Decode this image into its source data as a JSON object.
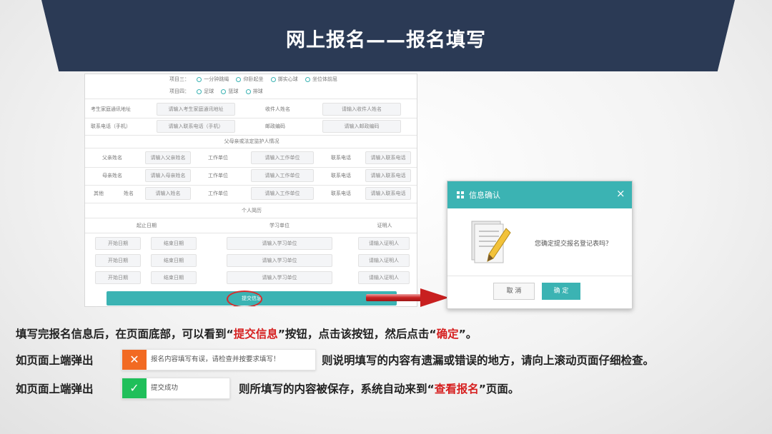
{
  "header": {
    "title": "网上报名——报名填写"
  },
  "form": {
    "top_items": [
      {
        "label": "项目三：",
        "options": [
          "一分钟跳绳",
          "仰卧起坐",
          "掷实心球",
          "坐位体前屈"
        ]
      },
      {
        "label": "项目四：",
        "options": [
          "足球",
          "篮球",
          "排球"
        ]
      }
    ],
    "fields": [
      {
        "label": "考生家庭通讯地址",
        "placeholder": "请输入考生家庭通讯地址",
        "label2": "收件人姓名",
        "placeholder2": "请输入收件人姓名"
      },
      {
        "label": "联系电话（手机）",
        "placeholder": "请输入联系电话（手机）",
        "label2": "邮政编码",
        "placeholder2": "请输入邮政编码"
      }
    ],
    "guardian_section": "父母亲或法定监护人情况",
    "guardians": [
      {
        "label": "父亲姓名",
        "placeholder": "请输入父亲姓名",
        "work_label": "工作单位",
        "work_placeholder": "请输入工作单位",
        "phone_label": "联系电话",
        "phone_placeholder": "请输入联系电话"
      },
      {
        "label": "母亲姓名",
        "placeholder": "请输入母亲姓名",
        "work_label": "工作单位",
        "work_placeholder": "请输入工作单位",
        "phone_label": "联系电话",
        "phone_placeholder": "请输入联系电话"
      },
      {
        "label": "其他",
        "label_b": "姓名",
        "placeholder": "请输入姓名",
        "work_label": "工作单位",
        "work_placeholder": "请输入工作单位",
        "phone_label": "联系电话",
        "phone_placeholder": "请输入联系电话"
      }
    ],
    "resume_section": "个人简历",
    "resume_headers": [
      "起止日期",
      "学习单位",
      "证明人"
    ],
    "resume_rows": [
      {
        "start": "开始日期",
        "end": "结束日期",
        "unit": "请输入学习单位",
        "witness": "请输入证明人"
      },
      {
        "start": "开始日期",
        "end": "结束日期",
        "unit": "请输入学习单位",
        "witness": "请输入证明人"
      },
      {
        "start": "开始日期",
        "end": "结束日期",
        "unit": "请输入学习单位",
        "witness": "请输入证明人"
      }
    ],
    "submit_label": "提交信息"
  },
  "dialog": {
    "title": "信息确认",
    "close": "×",
    "message": "您确定提交报名登记表吗？",
    "cancel": "取 消",
    "confirm": "确 定"
  },
  "instructions": {
    "line1": {
      "a": "填写完报名信息后，在页面底部，可以看到“",
      "b": "提交信息",
      "c": "”按钮，点击该按钮，然后点击“",
      "d": "确定",
      "e": "”。"
    },
    "line2": {
      "a": "如页面上端弹出",
      "toast": "报名内容填写有误，请检查并按要求填写！",
      "b": "则说明填写的内容有遗漏或错误的地方，请向上滚动页面仔细检查。"
    },
    "line3": {
      "a": "如页面上端弹出",
      "toast": "提交成功",
      "b": "则所填写的内容被保存，系统自动来到“",
      "c": "查看报名",
      "d": "”页面。"
    }
  },
  "colors": {
    "banner": "#2b3a55",
    "accent": "#3bb3b3",
    "highlight": "#d62020",
    "error_icon": "#f26a22",
    "success_icon": "#1fbf5a"
  },
  "icons": {
    "error": "close-icon",
    "success": "checkmark-icon",
    "dialog": "grid-icon",
    "document": "document-pencil-icon"
  }
}
